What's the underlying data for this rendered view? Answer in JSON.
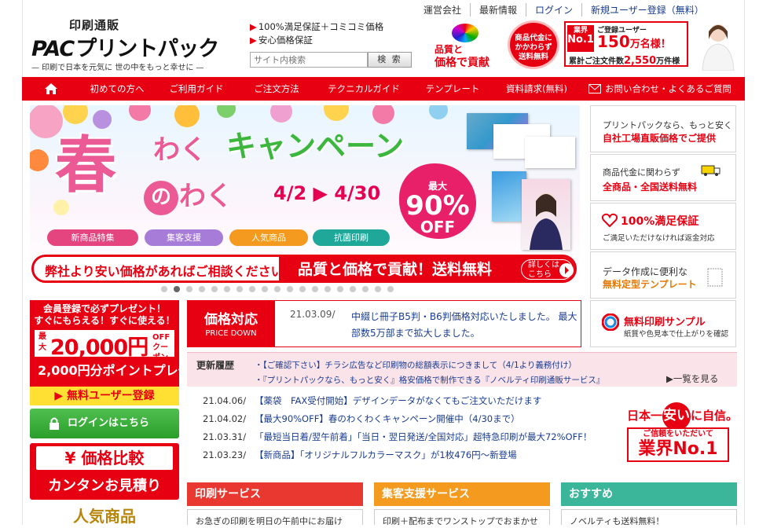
{
  "header": {
    "logo_top": "印刷通販",
    "logo_pac": "PAC",
    "logo_name": "プリントパック",
    "logo_tagline": "— 印刷で日本を元気に 世の中をもっと幸せに —",
    "promo1": "100%満足保証＋コミコミ価格",
    "promo2": "安心価格保証",
    "search_placeholder": "サイト内検索",
    "search_button": "検 索",
    "top_links": [
      "運営会社",
      "最新情報",
      "ログイン",
      "新規ユーザー登録（無料）"
    ],
    "quality_line1": "品質と",
    "quality_line2": "価格で貢献",
    "freeship": "商品代金に かかわらず 送料無料",
    "no1_badge_small": "業界",
    "no1_badge_big": "No.1",
    "no1_line1": "ご登録ユーザー",
    "no1_count": "150",
    "no1_unit": "万名様！",
    "no1_orders_label": "累計ご注文件数",
    "no1_orders": "2,550",
    "no1_orders_unit": "万件様"
  },
  "nav": {
    "items": [
      "初めての方へ",
      "ご利用ガイド",
      "ご注文方法",
      "テクニカルガイド",
      "テンプレート",
      "資料請求(無料)",
      "お問い合わせ・よくあるご質問"
    ]
  },
  "banner": {
    "haru": "春",
    "waku1": "わく",
    "campaign": "キャンペーン",
    "no": "の",
    "waku2": "わく",
    "date": "4/2 ▶ 4/30",
    "max": "最大",
    "pct": "90%",
    "off": "OFF",
    "pills": [
      "新商品特集",
      "集客支援",
      "人気商品",
      "抗菌印刷"
    ],
    "bar_left": "弊社より安い価格があればご相談ください！",
    "bar_right": "品質と価格で貢献！送料無料",
    "bar_detail": "詳しくは\nこちら"
  },
  "right_column": [
    {
      "line1": "プリントパックなら、もっと安く",
      "line2": "自社工場直販価格でご提供"
    },
    {
      "line1": "商品代金に関わらず",
      "line2": "全商品・全国送料無料"
    },
    {
      "line1": "100%満足保証",
      "line2": "ご満足いただけなければ返金対応"
    },
    {
      "line1": "データ作成に便利な",
      "line2": "無料定型テンプレート"
    },
    {
      "line1": "無料印刷サンプル",
      "line2": "紙質や色見本で仕上がりを確認"
    }
  ],
  "left_column": {
    "gift_line1": "会員登録で必ずプレゼント！",
    "gift_line2": "すぐにもらえる！すぐに使える！",
    "coupon_small": "最大",
    "coupon_value": "20,000円",
    "coupon_end": "OFF クーポン",
    "points": "2,000円分ポイントプレゼント！",
    "register": "▶ 無料ユーザー登録",
    "login": "ログインはこちら",
    "compare1": "¥ 価格比較",
    "compare2": "カンタンお見積り",
    "popular": "人気商品"
  },
  "news": {
    "price_title": "価格対応",
    "price_sub": "PRICE DOWN",
    "price_date": "21.03.09/",
    "price_text": "中綴じ冊子B5判・B6判価格対応いたしました。 最大部数5万部まで拡大しました。",
    "update_label": "更新履歴",
    "update_items": [
      "・【ご確認下さい】チラシ広告など印刷物の総額表示につきまして（4/1より義務付け）",
      "・『プリントパックなら、もっと安く』格安価格で制作できる『ノベルティ印刷通販サービス』"
    ],
    "more": "▶一覧を見る",
    "items": [
      {
        "date": "21.04.06/",
        "text": "【薬袋　FAX受付開始】デザインデータがなくてもご注文いただけます"
      },
      {
        "date": "21.04.02/",
        "text": "【最大90%OFF】春のわくわくキャンペーン開催中（4/30まで）"
      },
      {
        "date": "21.03.31/",
        "text": "「最短当日着/翌午前着」「当日・翌日発送/全国対応」超特急印刷が最大72%OFF！"
      },
      {
        "date": "21.03.23/",
        "text": "【新商品】「オリジナルフルカラーマスク」が1枚476円〜新登場"
      }
    ],
    "seal_top": "日本一",
    "seal_yasui": "安い",
    "seal_top2": "に自信。",
    "seal_sub": "ご信頼をいただいて",
    "seal_big": "業界No.1"
  },
  "sections": [
    {
      "title": "印刷サービス",
      "sub": "お急ぎの印刷を明日の午前中にお届け",
      "color": "#e8382f"
    },
    {
      "title": "集客支援サービス",
      "sub": "印刷＋配布までワンストップでおまかせ",
      "color": "#f39a1f"
    },
    {
      "title": "おすすめ",
      "sub": "ノベルティも送料無料！",
      "color": "#3cb69a"
    }
  ]
}
